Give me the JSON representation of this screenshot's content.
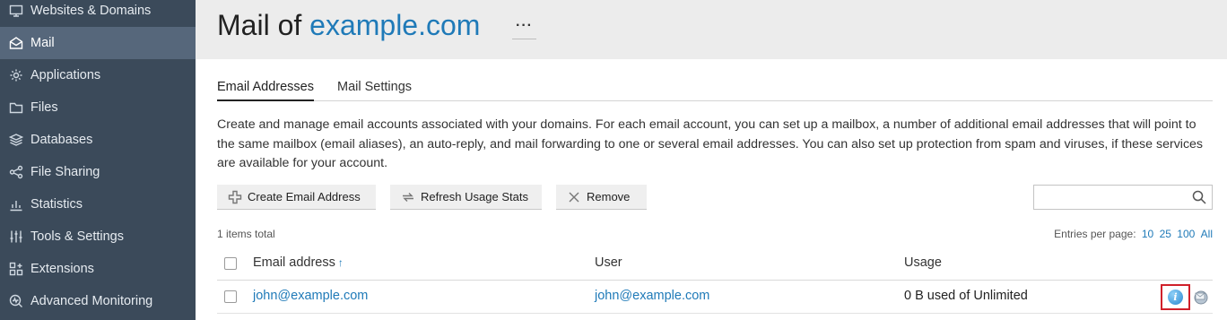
{
  "sidebar": {
    "items": [
      {
        "label": "Websites & Domains",
        "icon": "monitor-icon",
        "active": false
      },
      {
        "label": "Mail",
        "icon": "mail-icon",
        "active": true
      },
      {
        "label": "Applications",
        "icon": "gear-icon",
        "active": false
      },
      {
        "label": "Files",
        "icon": "folder-icon",
        "active": false
      },
      {
        "label": "Databases",
        "icon": "database-icon",
        "active": false
      },
      {
        "label": "File Sharing",
        "icon": "share-icon",
        "active": false
      },
      {
        "label": "Statistics",
        "icon": "bar-chart-icon",
        "active": false
      },
      {
        "label": "Tools & Settings",
        "icon": "sliders-icon",
        "active": false
      },
      {
        "label": "Extensions",
        "icon": "extensions-icon",
        "active": false
      },
      {
        "label": "Advanced Monitoring",
        "icon": "monitoring-icon",
        "active": false
      }
    ]
  },
  "header": {
    "title_prefix": "Mail of",
    "title_domain": "example.com",
    "more_label": "···"
  },
  "tabs": [
    {
      "label": "Email Addresses",
      "active": true
    },
    {
      "label": "Mail Settings",
      "active": false
    }
  ],
  "description": "Create and manage email accounts associated with your domains. For each email account, you can set up a mailbox, a number of additional email addresses that will point to the same mailbox (email aliases), an auto-reply, and mail forwarding to one or several email addresses. You can also set up protection from spam and viruses, if these services are available for your account.",
  "toolbar": {
    "create_label": "Create Email Address",
    "refresh_label": "Refresh Usage Stats",
    "remove_label": "Remove",
    "search_value": ""
  },
  "list": {
    "items_total": "1 items total",
    "per_page_label": "Entries per page:",
    "per_page_options": [
      "10",
      "25",
      "100",
      "All"
    ]
  },
  "table": {
    "columns": [
      "Email address",
      "User",
      "Usage"
    ],
    "sort_indicator": "↑",
    "rows": [
      {
        "email": "john@example.com",
        "user": "john@example.com",
        "usage": "0 B used of Unlimited"
      }
    ]
  },
  "colors": {
    "sidebar_bg": "#3b4a5a",
    "sidebar_active": "#56677b",
    "link": "#1f7ab8",
    "highlight": "#d0202a"
  }
}
